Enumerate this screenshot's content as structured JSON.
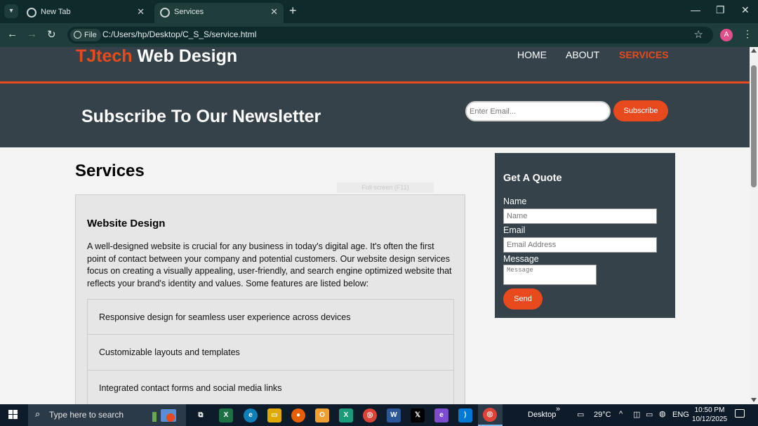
{
  "browser": {
    "tabs": [
      {
        "label": "New Tab",
        "icon": "chrome-icon",
        "active": false
      },
      {
        "label": "Services",
        "icon": "globe-icon",
        "active": true
      }
    ],
    "new_tab_symbol": "+",
    "address_chip": "File",
    "url": "C:/Users/hp/Desktop/C_S_S/service.html",
    "profile_initial": "A"
  },
  "site": {
    "logo_highlight": "TJtech",
    "logo_rest": " Web Design",
    "nav": [
      "HOME",
      "ABOUT",
      "SERVICES"
    ],
    "current_nav": "SERVICES",
    "accent_color": "#e8491d",
    "header_color": "#35424a"
  },
  "newsletter": {
    "heading": "Subscribe To Our Newsletter",
    "email_placeholder": "Enter Email...",
    "button": "Subscribe"
  },
  "main": {
    "page_title": "Services",
    "fullscreen_hint": "Full screen (F11)",
    "service": {
      "title": "Website Design",
      "description": "A well-designed website is crucial for any business in today's digital age. It's often the first point of contact between your company and potential customers. Our website design services focus on creating a visually appealing, user-friendly, and search engine optimized website that reflects your brand's identity and values. Some features are listed below:",
      "features": [
        "Responsive design for seamless user experience across devices",
        "Customizable layouts and templates",
        "Integrated contact forms and social media links"
      ]
    }
  },
  "quote": {
    "title": "Get A Quote",
    "name_label": "Name",
    "name_placeholder": "Name",
    "email_label": "Email",
    "email_placeholder": "Email Address",
    "message_label": "Message",
    "message_placeholder": "Message",
    "send": "Send"
  },
  "taskbar": {
    "search_placeholder": "Type here to search",
    "desktop_label": "Desktop",
    "more_symbol": "»",
    "temperature": "29°C",
    "language": "ENG",
    "time": "10:50 PM",
    "date": "10/12/2025"
  }
}
